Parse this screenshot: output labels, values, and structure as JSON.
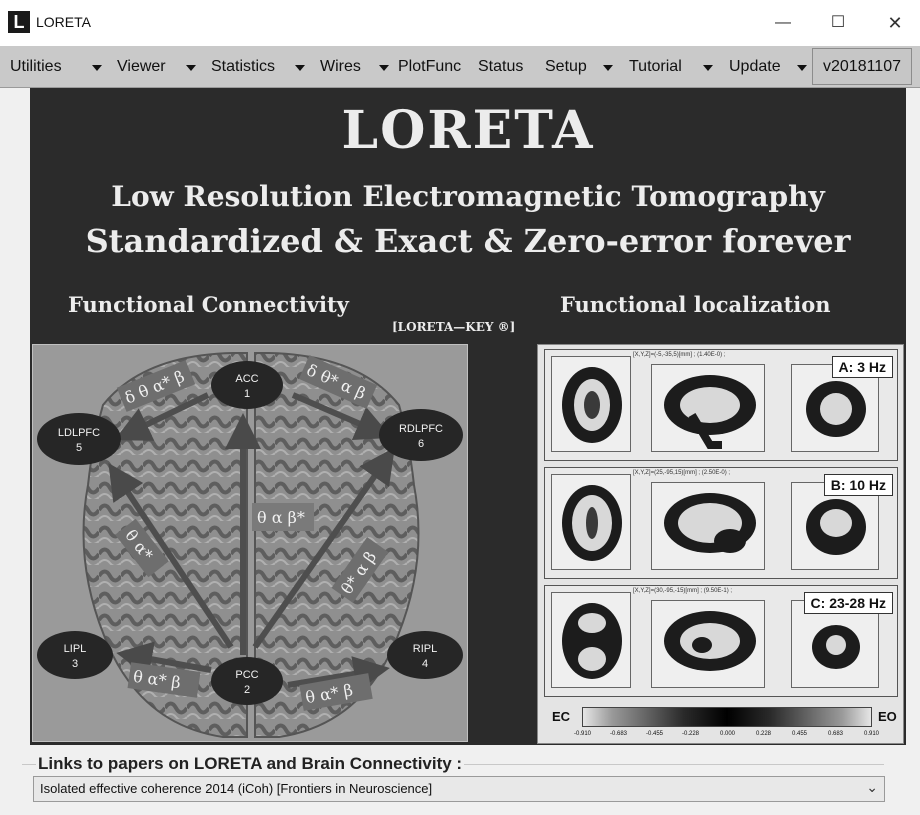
{
  "window": {
    "title": "LORETA",
    "logo_letter": "L",
    "controls": {
      "minimize": "—",
      "maximize": "☐",
      "close": "✕"
    }
  },
  "menu": {
    "items": [
      {
        "label": "Utilities",
        "has_dropdown": true
      },
      {
        "label": "Viewer",
        "has_dropdown": true
      },
      {
        "label": "Statistics",
        "has_dropdown": true
      },
      {
        "label": "Wires",
        "has_dropdown": true
      },
      {
        "label": "PlotFunc",
        "has_dropdown": false
      },
      {
        "label": "Status",
        "has_dropdown": false
      },
      {
        "label": "Setup",
        "has_dropdown": true
      },
      {
        "label": "Tutorial",
        "has_dropdown": true
      },
      {
        "label": "Update",
        "has_dropdown": true
      }
    ],
    "version": "v20181107"
  },
  "banner": {
    "title": "LORETA",
    "subtitle1": "Low Resolution Electromagnetic Tomography",
    "subtitle2": "Standardized & Exact & Zero-error forever",
    "functional_connectivity": "Functional Connectivity",
    "functional_localization": "Functional localization",
    "key_label": "[LORETA—KEY ®]"
  },
  "connectivity": {
    "nodes": [
      {
        "name": "ACC",
        "num": "1"
      },
      {
        "name": "PCC",
        "num": "2"
      },
      {
        "name": "LIPL",
        "num": "3"
      },
      {
        "name": "RIPL",
        "num": "4"
      },
      {
        "name": "LDLPFC",
        "num": "5"
      },
      {
        "name": "RDLPFC",
        "num": "6"
      }
    ],
    "edge_labels": [
      "δ θ α* β",
      "δ θ* α β",
      "θ α β*",
      "θ α*",
      "θ* α β",
      "θ α* β",
      "θ α* β"
    ]
  },
  "localization": {
    "rows": [
      {
        "badge": "A: 3 Hz",
        "coords": "[X,Y,Z]=(-5,-35,5)[mm] ; (1.40E-0) ;"
      },
      {
        "badge": "B: 10 Hz",
        "coords": "[X,Y,Z]=(25,-95,15)[mm] ; (2.50E-0) ;"
      },
      {
        "badge": "C: 23-28 Hz",
        "coords": "[X,Y,Z]=(30,-95,-15)[mm] ; (9.50E-1) ;"
      }
    ],
    "colorbar": {
      "left_label": "EC",
      "right_label": "EO",
      "ticks": [
        "-0.910",
        "-0.683",
        "-0.455",
        "-0.228",
        "0.000",
        "0.228",
        "0.455",
        "0.683",
        "0.910"
      ]
    }
  },
  "links": {
    "label": "Links to papers on LORETA and Brain Connectivity :",
    "selected": "Isolated effective coherence 2014 (iCoh) [Frontiers in Neuroscience]"
  }
}
